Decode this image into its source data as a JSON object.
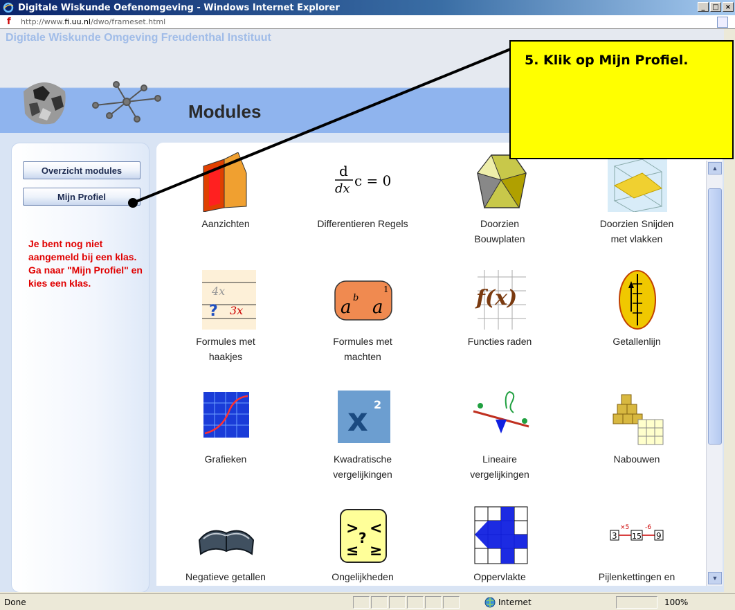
{
  "window": {
    "title": "Digitale Wiskunde Oefenomgeving - Windows Internet Explorer"
  },
  "address": {
    "url_prefix": "http://www.",
    "url_domain": "fi.uu.nl",
    "url_path": "/dwo/frameset.html"
  },
  "banner": {
    "site_title": "Digitale Wiskunde Omgeving  Freudenthal Instituut",
    "heading": "Modules"
  },
  "sidebar": {
    "buttons": [
      {
        "label": "Overzicht modules"
      },
      {
        "label": "Mijn Profiel"
      }
    ],
    "note": "Je bent nog niet aangemeld bij een klas. Ga naar \"Mijn Profiel\" en kies een klas."
  },
  "modules": [
    {
      "label": "Aanzichten",
      "icon": "aanzichten-icon"
    },
    {
      "label": "Differentieren Regels",
      "icon": "differentieren-icon"
    },
    {
      "label": "Doorzien\nBouwplaten",
      "icon": "bouwplaten-icon"
    },
    {
      "label": "Doorzien Snijden\nmet vlakken",
      "icon": "snijden-icon"
    },
    {
      "label": "Formules met\nhaakjes",
      "icon": "haakjes-icon"
    },
    {
      "label": "Formules met\nmachten",
      "icon": "machten-icon"
    },
    {
      "label": "Functies raden",
      "icon": "functies-icon"
    },
    {
      "label": "Getallenlijn",
      "icon": "getallenlijn-icon"
    },
    {
      "label": "Grafieken",
      "icon": "grafieken-icon"
    },
    {
      "label": "Kwadratische\nvergelijkingen",
      "icon": "kwadratisch-icon"
    },
    {
      "label": "Lineaire\nvergelijkingen",
      "icon": "lineair-icon"
    },
    {
      "label": "Nabouwen",
      "icon": "nabouwen-icon"
    },
    {
      "label": "Negatieve getallen",
      "icon": "negatief-icon"
    },
    {
      "label": "Ongelijkheden",
      "icon": "ongelijkheden-icon"
    },
    {
      "label": "Oppervlakte",
      "icon": "oppervlakte-icon"
    },
    {
      "label": "Pijlenkettingen en",
      "icon": "pijlenkettingen-icon"
    }
  ],
  "icon_texts": {
    "diff_num": "d",
    "diff_den": "dx",
    "diff_rhs": "c = 0",
    "haakjes_a": "4x",
    "haakjes_b": "3x",
    "haakjes_q": "?",
    "machten": "a",
    "machten_b": "b",
    "machten_exp": "1",
    "functies": "f(x)",
    "kwadratisch": "x",
    "kwadratisch_exp": "2",
    "ongelijkheden_1": ">",
    "ongelijkheden_2": "<",
    "ongelijkheden_3": "≤",
    "ongelijkheden_4": "≥",
    "ongelijkheden_q": "?",
    "pijl_a": "3",
    "pijl_b": "15",
    "pijl_c": "9",
    "pijl_op1": "×5",
    "pijl_op2": "-6"
  },
  "status": {
    "text": "Done",
    "zone": "Internet",
    "zoom": "100%"
  },
  "callout": {
    "text": "5. Klik op Mijn Profiel."
  },
  "colors": {
    "titlebar": "#0a246a",
    "callout": "#ffff00",
    "note": "#e00000",
    "banner_band": "#8fb4ee"
  }
}
